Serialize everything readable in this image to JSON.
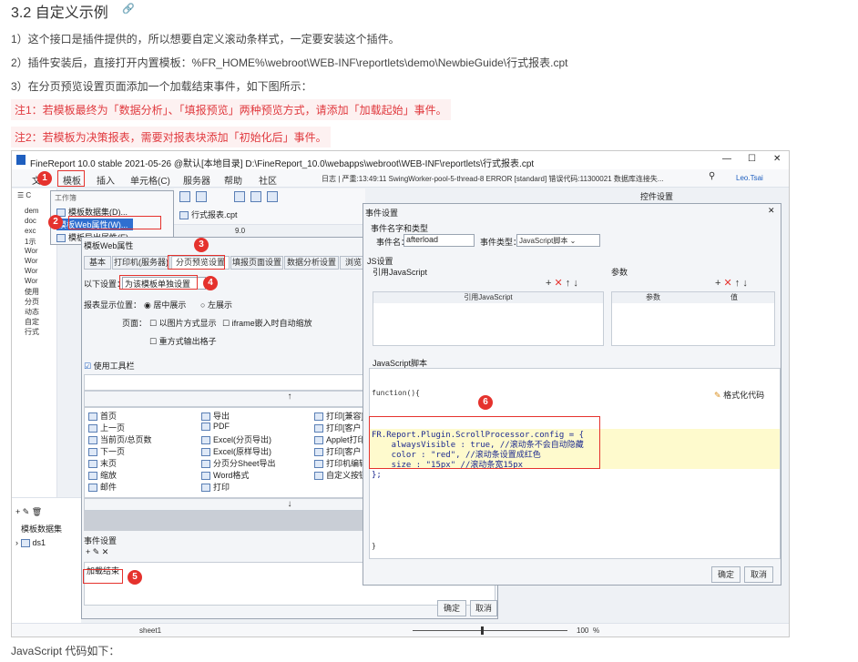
{
  "doc": {
    "heading": "3.2 自定义示例",
    "anchor_icon": "link-icon",
    "p1": "1）这个接口是插件提供的，所以想要自定义滚动条样式，一定要安装这个插件。",
    "p2": "2）插件安装后，直接打开内置模板：%FR_HOME%\\webroot\\WEB-INF\\reportlets\\demo\\NewbieGuide\\行式报表.cpt",
    "p3": "3）在分页预览设置页面添加一个加载结束事件，如下图所示：",
    "note1": "注1：若模板最终为「数据分析」、「填报预览」两种预览方式，请添加「加载起始」事件。",
    "note2": "注2：若模板为决策报表，需要对报表块添加「初始化后」事件。",
    "footer": "JavaScript 代码如下："
  },
  "app": {
    "title": "FineReport 10.0 stable 2021-05-26 @默认[本地目录]    D:\\FineReport_10.0\\webapps\\webroot\\WEB-INF\\reportlets\\行式报表.cpt",
    "win_min": "—",
    "win_max": "☐",
    "win_close": "✕",
    "menu": [
      "文件",
      "模板",
      "插入",
      "单元格(C)",
      "服务器",
      "帮助",
      "社区"
    ],
    "log": "日志 | 严重:13:49:11 SwingWorker-pool-5-thread-8 ERROR [standard] 错误代码:11300021 数据库连接失...",
    "user": "Leo.Tsai",
    "side_label": "控件设置",
    "toolbar_label": "工作簿",
    "tree_items": [
      "模板数据集(D)...",
      "模板Web属性(W)...",
      "模板导出属性(E)..."
    ],
    "left_tree": [
      "dem",
      "doc",
      "exc",
      "1示",
      "Wor",
      "Wor",
      "Wor",
      "Wor",
      "使用",
      "分页",
      "动态",
      "自定",
      "行式"
    ],
    "left_bottom_title": "模板数据集",
    "ds": "ds1",
    "tab_file": "行式报表.cpt",
    "font_size": "9.0",
    "sheet": "sheet1",
    "zoom": "100",
    "zoom_pct": "%"
  },
  "web_dialog": {
    "title": "模板Web属性",
    "tabs": [
      "基本",
      "打印机(服务器)",
      "分页预览设置",
      "填报页面设置",
      "数据分析设置",
      "浏览"
    ],
    "setting_label": "以下设置：",
    "setting_value": "为该模板单独设置",
    "position_label": "报表显示位置：",
    "pos_center": "居中展示",
    "pos_left": "左展示",
    "page_label": "页面：",
    "opt1": "以图片方式显示",
    "opt2": "iframe嵌入时自动缩放",
    "opt3": "重方式输出格子",
    "toolbar_check": "使用工具栏",
    "buttons_col1": [
      "首页",
      "上一页",
      "当前页/总页数",
      "下一页",
      "末页",
      "缩放",
      "邮件"
    ],
    "buttons_col2": [
      "导出",
      "PDF",
      "Excel(分页导出)",
      "Excel(原样导出)",
      "分页分Sheet导出",
      "Word格式",
      "打印"
    ],
    "buttons_col3": [
      "打印[兼容]",
      "打印[客户",
      "Applet打印",
      "打印[客户",
      "打印机编辑",
      "自定义按钮",
      ""
    ],
    "event_title": "事件设置",
    "event_item": "加载结束",
    "ok": "确定",
    "cancel": "取消"
  },
  "event_dialog": {
    "title": "事件设置",
    "name_type_title": "事件名字和类型",
    "name_label": "事件名：",
    "name_value": "afterload",
    "type_label": "事件类型：",
    "type_value": "JavaScript脚本",
    "js_title": "JS设置",
    "ref_label": "引用JavaScript",
    "param_label": "参数",
    "col_ref": "引用JavaScript",
    "col_param": "参数",
    "col_value": "值",
    "script_title": "JavaScript脚本",
    "func": "function(){",
    "format": "格式化代码",
    "code": [
      "FR.Report.Plugin.ScrollProcessor.config = {",
      "    alwaysVisible : true, //滚动条不会自动隐藏",
      "    color : \"red\", //滚动条设置成红色",
      "    size : \"15px\" //滚动条宽15px",
      "};"
    ],
    "close_brace": "}",
    "ok": "确定",
    "cancel": "取消"
  },
  "badges": [
    "1",
    "2",
    "3",
    "4",
    "5",
    "6"
  ],
  "colors": {
    "accent_red": "#e5322d",
    "note_red": "#e0393e",
    "link_blue": "#2f6fd0"
  }
}
